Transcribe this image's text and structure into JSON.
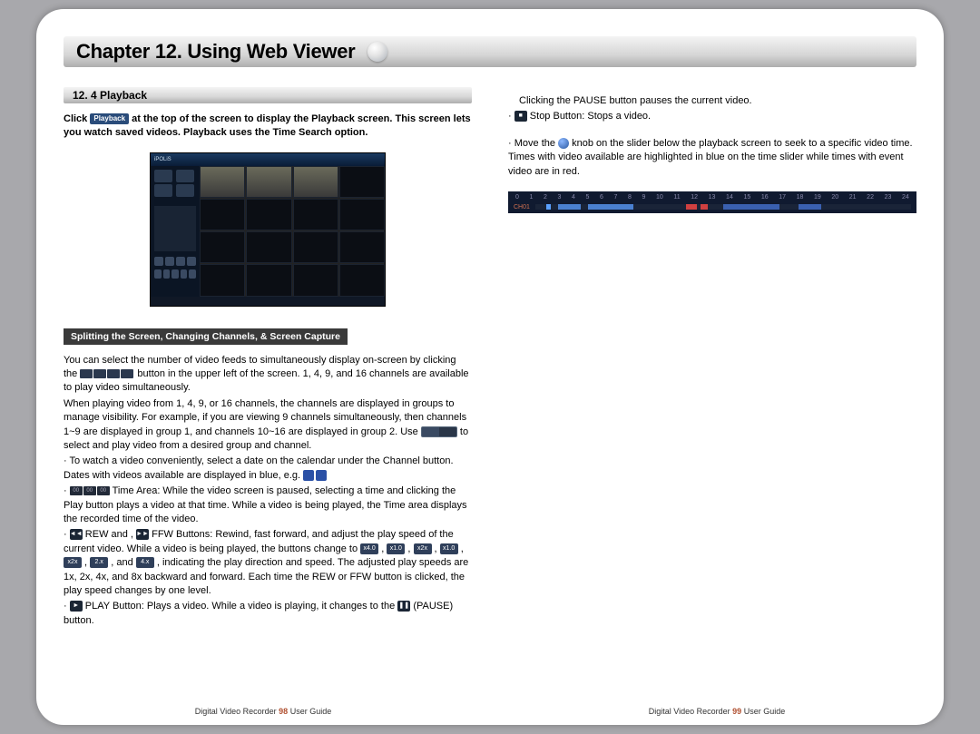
{
  "chapter_title": "Chapter 12. Using Web Viewer",
  "section_heading": "12. 4 Playback",
  "intro_click": "Click",
  "intro_playback_btn": "Playback",
  "intro_rest": "at the top of the screen to display the Playback screen. This screen lets you watch saved videos. Playback uses the Time Search option.",
  "sub_badge": "Splitting the Screen, Changing Channels, & Screen Capture",
  "p1a": "You can select the number of video feeds to simultaneously display on-screen by clicking the",
  "p1b": "button in the upper left of the screen. 1, 4, 9, and 16 channels are available to play video simultaneously.",
  "p2": "When playing video from 1, 4, 9, or 16 channels, the channels are displayed in groups to manage visibility. For example, if you are viewing 9 channels simultaneously, then channels 1~9 are displayed in group 1, and channels 10~16 are displayed in group 2. Use",
  "p2b": "to select and play video from a desired group and channel.",
  "b1a": "To watch a video conveniently, select a date on the calendar under the Channel button.  Dates with videos available are displayed in blue, e.g.",
  "b2a": "Time Area: While the video screen is paused, selecting a time and clicking the Play button plays a video at that time. While a video is being played, the Time area displays the recorded time of the video.",
  "b3a": "REW and ,",
  "b3b": "FFW Buttons: Rewind, fast forward, and adjust the play speed of the current video. While a video is being played, the buttons change to",
  "b3c": ", indicating the play direction and speed. The adjusted play speeds are 1x, 2x, 4x, and 8x backward and forward. Each time the REW or FFW button is clicked, the play speed changes by one level.",
  "b4a": "PLAY Button: Plays a video. While a video is playing, it changes to the",
  "b4b": "(PAUSE) button.",
  "r1": "Clicking the PAUSE button pauses the current video.",
  "r2": "Stop Button: Stops a video.",
  "r3a": "Move the",
  "r3b": "knob on the slider below the playback screen to seek to a specific video time. Times with video available are highlighted in blue on the time slider while times with event video are in red.",
  "timeline_label": "CH01",
  "timeline_ticks": [
    "0",
    "1",
    "2",
    "3",
    "4",
    "5",
    "6",
    "7",
    "8",
    "9",
    "10",
    "11",
    "12",
    "13",
    "14",
    "15",
    "16",
    "17",
    "18",
    "19",
    "20",
    "21",
    "22",
    "23",
    "24"
  ],
  "speed_labels": [
    "x4.0",
    "x1.0",
    "x2x",
    "x1.0",
    "x2x",
    "2.x",
    "4.x"
  ],
  "footer_left_a": "Digital Video Recorder",
  "footer_left_pg": "98",
  "footer_left_b": "User Guide",
  "footer_right_a": "Digital Video Recorder",
  "footer_right_pg": "99",
  "footer_right_b": "User Guide",
  "and_label": "and"
}
